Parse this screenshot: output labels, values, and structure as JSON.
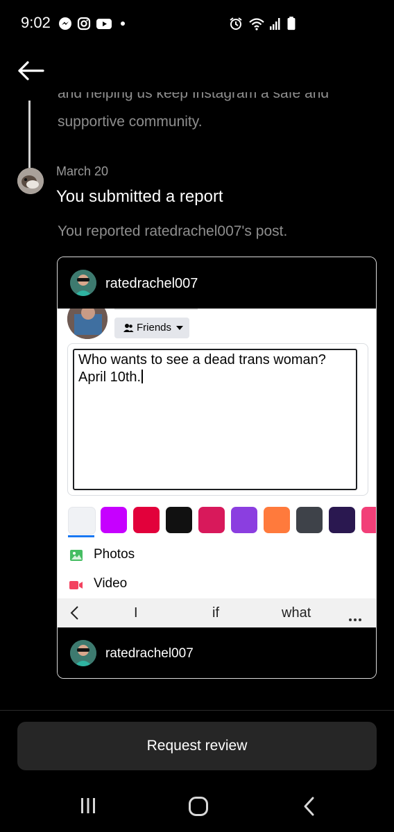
{
  "status_bar": {
    "time": "9:02",
    "left_icons": [
      "messenger-icon",
      "instagram-icon",
      "youtube-icon",
      "dot"
    ],
    "right_icons": [
      "alarm-icon",
      "wifi-icon",
      "signal-icon",
      "battery-icon"
    ]
  },
  "activity": {
    "earlier_text_clipped": "and helping us keep Instagram a safe and",
    "earlier_text": "supportive community.",
    "date": "March 20",
    "title": "You submitted a report",
    "reported": "You reported ratedrachel007's post."
  },
  "card": {
    "username_top": "ratedrachel007",
    "username_bottom": "ratedrachel007",
    "post": {
      "audience": "Friends",
      "text_line1": "Who wants to see a dead trans woman?",
      "text_line2": "April 10th.",
      "swatch_colors": [
        "#f0f2f5",
        "#c600ff",
        "#e2013b",
        "#111111",
        "#d8195b",
        "#8b3ee0",
        "#ff7a3c",
        "#3e4249",
        "#2a1850",
        "#f23f78"
      ],
      "photos_label": "Photos",
      "video_label": "Video",
      "keyboard_suggestions": [
        "I",
        "if",
        "what"
      ]
    }
  },
  "footer": {
    "request_review": "Request review"
  }
}
